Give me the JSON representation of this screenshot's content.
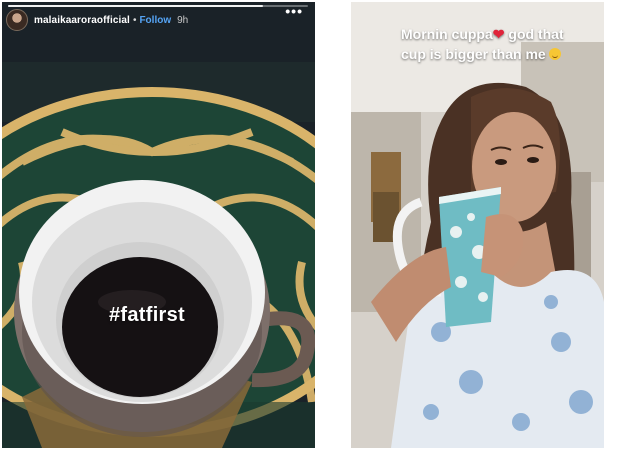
{
  "left_story": {
    "header": {
      "username": "malaikaaroraofficial",
      "separator": "•",
      "follow_label": "Follow",
      "time_ago": "9h",
      "more_label": "•••"
    },
    "progress": 0.85,
    "sticker_text": "#fatfirst"
  },
  "right_story": {
    "caption_part1": "Mornin cuppa",
    "heart": "❤",
    "caption_part2": " god that cup is bigger than me"
  },
  "colors": {
    "follow_blue": "#55a4f5",
    "placemat_green": "#1f4a3c",
    "placemat_gold": "#d9b46a",
    "mug_teal": "#6fbcc4",
    "heart_red": "#e0243a"
  }
}
